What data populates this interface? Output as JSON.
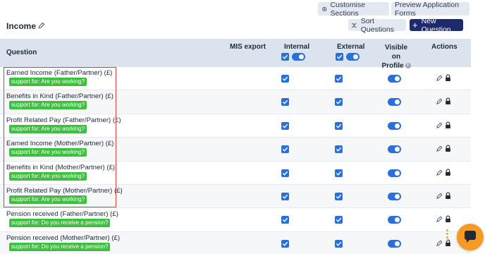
{
  "toolbar": {
    "customise_label": "Customise Sections",
    "preview_label": "Preview Application Forms"
  },
  "section": {
    "title": "Income",
    "sort_label": "Sort Questions",
    "new_label": "New Question"
  },
  "table": {
    "headers": {
      "question": "Question",
      "mis_export": "MIS export",
      "internal": "Internal",
      "external": "External",
      "visible": "Visible on Profile",
      "actions": "Actions"
    },
    "header_controls": {
      "internal_checked": true,
      "internal_toggle_on": true,
      "external_checked": true,
      "external_toggle_on": true
    },
    "rows": [
      {
        "question": "Earned Income (Father/Partner) (£)",
        "badge": "support for: Are you working?",
        "internal": true,
        "external": true,
        "visible": true
      },
      {
        "question": "Benefits in Kind (Father/Partner) (£)",
        "badge": "support for: Are you working?",
        "internal": true,
        "external": true,
        "visible": true
      },
      {
        "question": "Profit Related Pay (Father/Partner) (£)",
        "badge": "support for: Are you working?",
        "internal": true,
        "external": true,
        "visible": true
      },
      {
        "question": "Earned Income (Mother/Partner) (£)",
        "badge": "support for: Are you working?",
        "internal": true,
        "external": true,
        "visible": true
      },
      {
        "question": "Benefits in Kind (Mother/Partner) (£)",
        "badge": "support for: Are you working?",
        "internal": true,
        "external": true,
        "visible": true
      },
      {
        "question": "Profit Related Pay (Mother/Partner) (£)",
        "badge": "support for: Are you working?",
        "internal": true,
        "external": true,
        "visible": true
      },
      {
        "question": "Pension received (Father/Partner) (£)",
        "badge": "support for: Do you receive a pension?",
        "internal": true,
        "external": true,
        "visible": true
      },
      {
        "question": "Pension received (Mother/Partner) (£)",
        "badge": "support for: Do you receive a pension?",
        "internal": true,
        "external": true,
        "visible": true
      }
    ]
  },
  "colors": {
    "accent": "#2a6fdb",
    "primary_button": "#1e2a6e",
    "badge": "#3fbf3f",
    "header_bg": "#dbe3ef",
    "highlight": "#e03b3b",
    "chat": "#f59a23"
  },
  "icons": {
    "customise": "gear-icon",
    "sort": "shuffle-icon",
    "new": "plus-icon",
    "edit": "pencil-icon",
    "lock": "lock-icon",
    "info": "info-icon",
    "chat": "chat-icon"
  }
}
